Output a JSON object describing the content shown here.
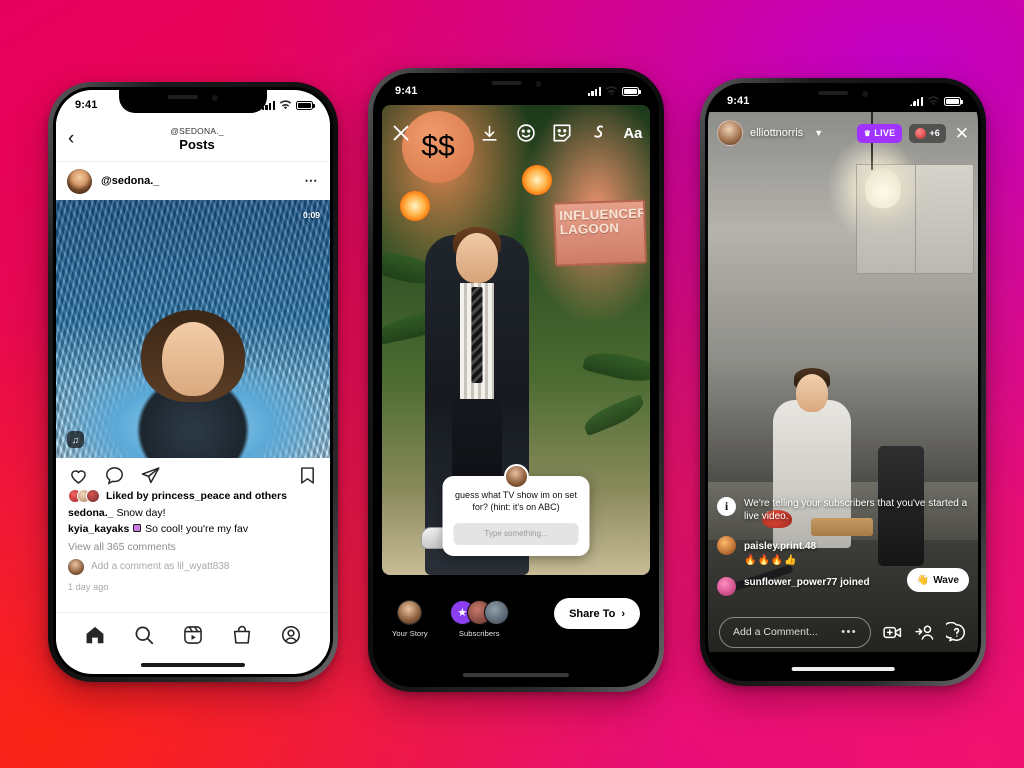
{
  "background": {
    "colors": [
      "#e8005e",
      "#c200c6",
      "#fb2414",
      "#f2136f"
    ]
  },
  "phone1": {
    "name": "instagram-feed-post",
    "status": {
      "time": "9:41"
    },
    "header": {
      "back_icon": "chevron-left-icon",
      "username": "@SEDONA._",
      "title": "Posts"
    },
    "post": {
      "avatar": "sedona-avatar",
      "username": "@sedona._",
      "more_icon": "more-options-icon",
      "video_timestamp": "0:09",
      "audio_icon": "audio-toggle-icon"
    },
    "actions": {
      "like": "heart-icon",
      "comment": "comment-icon",
      "share": "share-icon",
      "save": "bookmark-icon"
    },
    "details": {
      "liked_by": "Liked by princess_peace and others",
      "caption_user": "sedona._",
      "caption_text": "Snow day!",
      "comment_user": "kyia_kayaks",
      "comment_text": "So cool! you're my fav",
      "view_all": "View all 365 comments",
      "add_comment": "Add a comment as lil_wyatt838",
      "timestamp": "1 day ago"
    },
    "nav": [
      {
        "name": "home",
        "icon": "home-icon"
      },
      {
        "name": "search",
        "icon": "search-icon"
      },
      {
        "name": "reels",
        "icon": "reels-icon"
      },
      {
        "name": "shop",
        "icon": "shop-icon"
      },
      {
        "name": "profile",
        "icon": "profile-icon"
      }
    ]
  },
  "phone2": {
    "name": "instagram-story-composer",
    "status": {
      "time": "9:41"
    },
    "toolbar": [
      {
        "name": "close",
        "icon": "close-icon",
        "label": "✕"
      },
      {
        "name": "save",
        "icon": "download-icon"
      },
      {
        "name": "effects",
        "icon": "smiley-face-icon"
      },
      {
        "name": "sticker",
        "icon": "sticker-icon"
      },
      {
        "name": "draw",
        "icon": "squiggle-draw-icon"
      },
      {
        "name": "text",
        "icon": "text-aa-icon",
        "label": "Aa"
      }
    ],
    "scene": {
      "sign_text": "INFLUENCER LAGOON"
    },
    "question_sticker": {
      "question": "guess what TV show im on set for? (hint: it's on ABC)",
      "input_placeholder": "Type something..."
    },
    "share_options": [
      {
        "label": "Your Story",
        "name": "your-story-option"
      },
      {
        "label": "Subscribers",
        "name": "subscribers-option"
      }
    ],
    "share_button": {
      "label": "Share To",
      "chevron": "›"
    }
  },
  "phone3": {
    "name": "instagram-live-broadcast",
    "status": {
      "time": "9:41"
    },
    "header": {
      "avatar": "broadcaster-avatar",
      "username": "elliottnorris",
      "chevron": "chevron-down-icon",
      "live_badge": "LIVE",
      "live_crown": "crown-icon",
      "viewer_count": "+6",
      "close_icon": "close-icon"
    },
    "feed": {
      "system_message": "We're telling your subscribers that you've started a live video.",
      "comments": [
        {
          "user": "paisley.print.48",
          "text": "🔥🔥🔥👍"
        },
        {
          "user": "sunflower_power77 joined",
          "text": ""
        }
      ],
      "wave_button": {
        "label": "Wave",
        "emoji": "👋"
      }
    },
    "bottom": {
      "comment_placeholder": "Add a Comment...",
      "more_dots": "•••",
      "add_video_icon": "add-video-icon",
      "invite_icon": "add-person-icon",
      "help_icon": "question-circle-icon"
    }
  }
}
